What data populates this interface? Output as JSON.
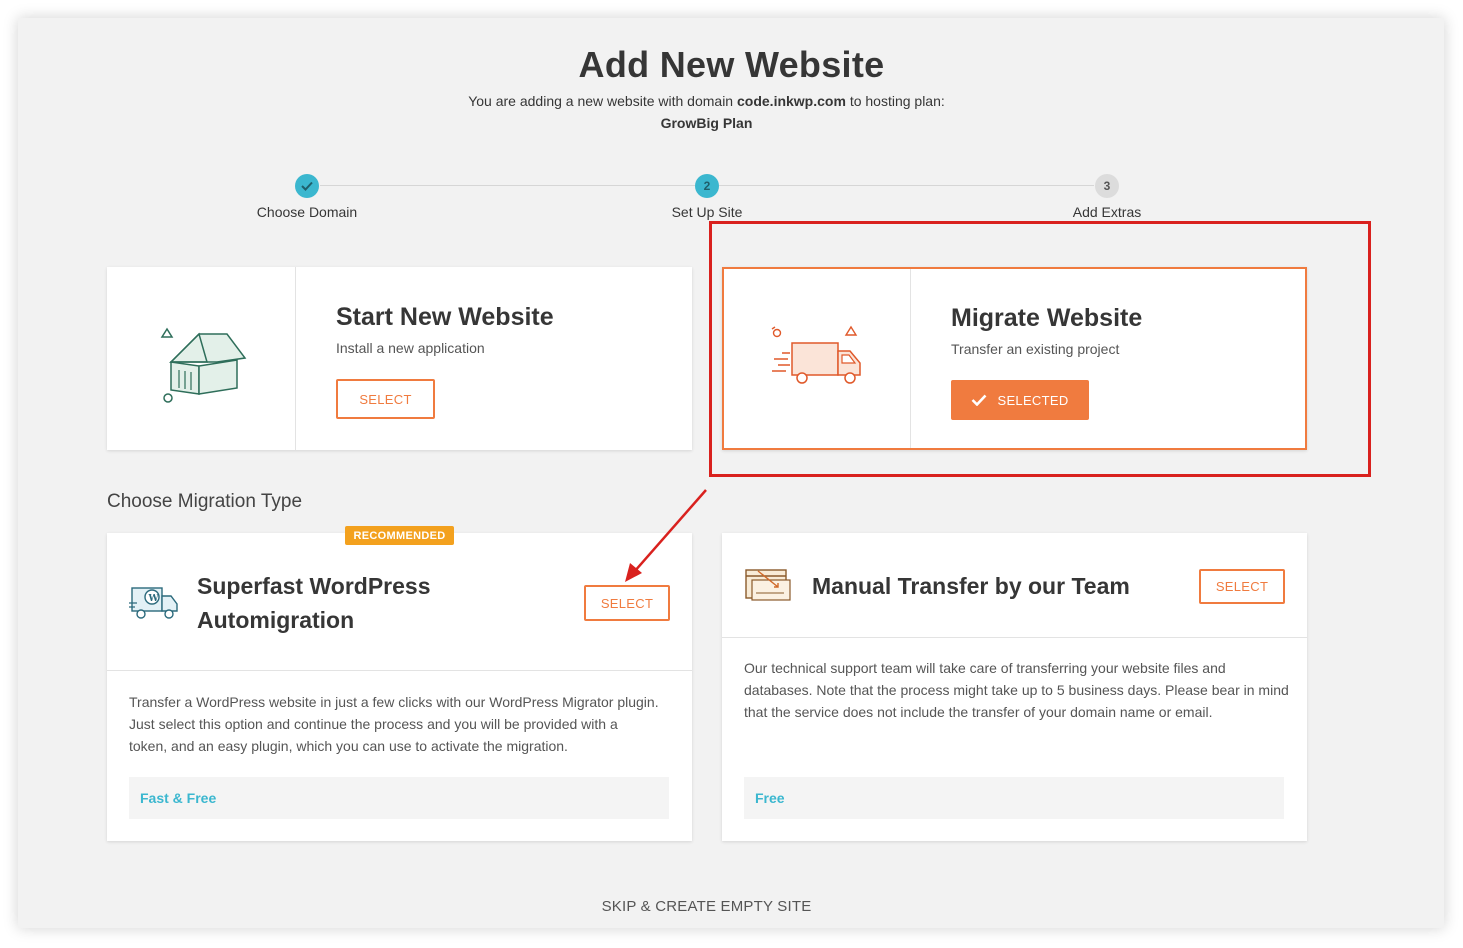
{
  "header": {
    "title": "Add New Website",
    "subtitle_prefix": "You are adding a new website with domain",
    "domain": "code.inkwp.com",
    "subtitle_suffix": "to hosting plan:",
    "plan": "GrowBig Plan"
  },
  "steps": [
    {
      "label": "Choose Domain",
      "state": "done",
      "icon": "check-icon"
    },
    {
      "label": "Set Up Site",
      "state": "active",
      "number": "2"
    },
    {
      "label": "Add Extras",
      "state": "todo",
      "number": "3"
    }
  ],
  "options": {
    "start": {
      "title": "Start New Website",
      "subtitle": "Install a new application",
      "button": "SELECT",
      "icon": "house-icon"
    },
    "migrate": {
      "title": "Migrate Website",
      "subtitle": "Transfer an existing project",
      "button": "SELECTED",
      "icon": "truck-icon"
    }
  },
  "migration": {
    "section_title": "Choose Migration Type",
    "auto": {
      "badge": "RECOMMENDED",
      "title_line1": "Superfast WordPress",
      "title_line2": "Automigration",
      "button": "SELECT",
      "description": "Transfer a WordPress website in just a few clicks with our WordPress Migrator plugin. Just select this option and continue the process and you will be provided with a token, and an easy plugin, which you can use to activate the migration.",
      "tag": "Fast & Free",
      "icon": "wordpress-truck-icon"
    },
    "manual": {
      "title": "Manual Transfer by our Team",
      "button": "SELECT",
      "description": "Our technical support team will take care of transferring your website files and databases. Note that the process might take up to 5 business days. Please bear in mind that the service does not include the transfer of your domain name or email.",
      "tag": "Free",
      "icon": "browser-transfer-icon"
    }
  },
  "footer": {
    "skip": "SKIP & CREATE EMPTY SITE"
  },
  "colors": {
    "accent": "#f07b3f",
    "teal": "#3bb7cf",
    "annotation_red": "#d9211e",
    "badge": "#f3a11e"
  }
}
